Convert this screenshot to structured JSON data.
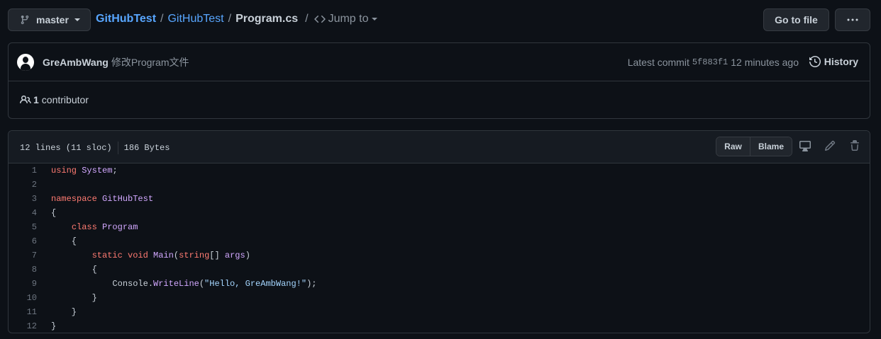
{
  "branch": {
    "name": "master",
    "icon": "git-branch-icon"
  },
  "breadcrumb": {
    "repo": "GitHubTest",
    "folder": "GitHubTest",
    "sep": "/",
    "file": "Program.cs",
    "jump_to": "Jump to"
  },
  "actions": {
    "go_to_file": "Go to file",
    "more": "more-options-icon"
  },
  "commit": {
    "author": "GreAmbWang",
    "message": "修改Program文件",
    "latest_label": "Latest commit",
    "sha": "5f883f1",
    "time": "12 minutes ago",
    "history_label": "History"
  },
  "contributors": {
    "count": "1",
    "label": "contributor"
  },
  "file": {
    "lines_info": "12 lines (11 sloc)",
    "size": "186 Bytes",
    "raw_label": "Raw",
    "blame_label": "Blame"
  },
  "code_lines": [
    {
      "n": "1",
      "tokens": [
        {
          "t": "using",
          "c": "kw"
        },
        {
          "t": " "
        },
        {
          "t": "System",
          "c": "ent"
        },
        {
          "t": ";"
        }
      ]
    },
    {
      "n": "2",
      "tokens": []
    },
    {
      "n": "3",
      "tokens": [
        {
          "t": "namespace",
          "c": "kw"
        },
        {
          "t": " "
        },
        {
          "t": "GitHubTest",
          "c": "ent"
        }
      ]
    },
    {
      "n": "4",
      "tokens": [
        {
          "t": "{"
        }
      ]
    },
    {
      "n": "5",
      "tokens": [
        {
          "t": "    "
        },
        {
          "t": "class",
          "c": "kw"
        },
        {
          "t": " "
        },
        {
          "t": "Program",
          "c": "ent"
        }
      ]
    },
    {
      "n": "6",
      "tokens": [
        {
          "t": "    {"
        }
      ]
    },
    {
      "n": "7",
      "tokens": [
        {
          "t": "        "
        },
        {
          "t": "static",
          "c": "kw"
        },
        {
          "t": " "
        },
        {
          "t": "void",
          "c": "kw"
        },
        {
          "t": " "
        },
        {
          "t": "Main",
          "c": "ent"
        },
        {
          "t": "("
        },
        {
          "t": "string",
          "c": "kw"
        },
        {
          "t": "[] "
        },
        {
          "t": "args",
          "c": "var"
        },
        {
          "t": ")"
        }
      ]
    },
    {
      "n": "8",
      "tokens": [
        {
          "t": "        {"
        }
      ]
    },
    {
      "n": "9",
      "tokens": [
        {
          "t": "            Console."
        },
        {
          "t": "WriteLine",
          "c": "ent"
        },
        {
          "t": "("
        },
        {
          "t": "\"Hello, GreAmbWang!\"",
          "c": "str"
        },
        {
          "t": ");"
        }
      ]
    },
    {
      "n": "10",
      "tokens": [
        {
          "t": "        }"
        }
      ]
    },
    {
      "n": "11",
      "tokens": [
        {
          "t": "    }"
        }
      ]
    },
    {
      "n": "12",
      "tokens": [
        {
          "t": "}"
        }
      ]
    }
  ]
}
